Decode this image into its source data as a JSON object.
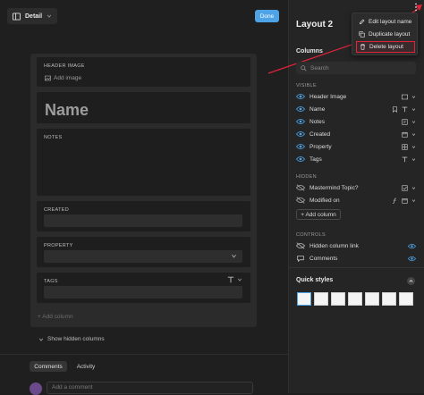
{
  "topbar": {
    "view_label": "Detail",
    "done_label": "Done"
  },
  "card": {
    "header_image_label": "HEADER IMAGE",
    "add_image_label": "Add image",
    "name_placeholder": "Name",
    "notes_label": "NOTES",
    "created_label": "CREATED",
    "property_label": "PROPERTY",
    "tags_label": "TAGS",
    "add_column_label": "+ Add column"
  },
  "show_hidden_label": "Show hidden columns",
  "tabs": {
    "comments": "Comments",
    "activity": "Activity"
  },
  "comment_placeholder": "Add a comment",
  "panel": {
    "title": "Layout 2",
    "menu": {
      "edit": "Edit layout name",
      "duplicate": "Duplicate layout",
      "delete": "Delete layout"
    },
    "columns_heading": "Columns",
    "search_placeholder": "Search",
    "visible_label": "VISIBLE",
    "visible_items": [
      "Header Image",
      "Name",
      "Notes",
      "Created",
      "Property",
      "Tags"
    ],
    "hidden_label": "HIDDEN",
    "hidden_items": [
      "Mastermind Topic?",
      "Modified on"
    ],
    "add_column_label": "+ Add column",
    "controls_label": "CONTROLS",
    "controls": [
      "Hidden column link",
      "Comments"
    ],
    "quick_styles_label": "Quick styles"
  },
  "colors": {
    "accent": "#4da3e6",
    "highlight": "#e0233a"
  }
}
